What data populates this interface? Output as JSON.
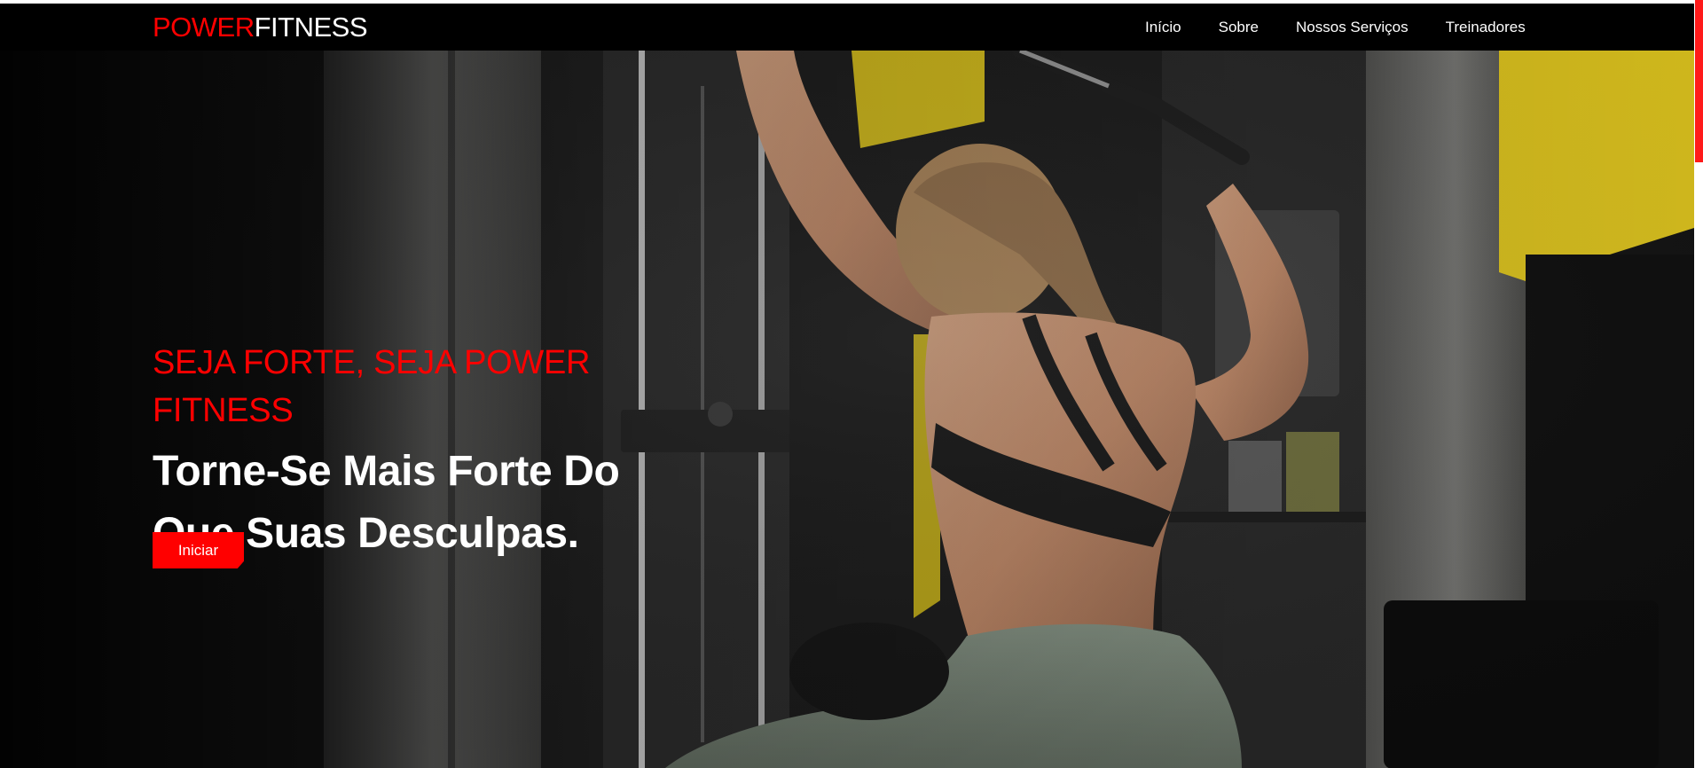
{
  "brand": {
    "part1": "POWER",
    "part2": "FITNESS",
    "color_part1": "#ff0000",
    "color_part2": "#ffffff"
  },
  "nav": {
    "items": [
      {
        "label": "Início"
      },
      {
        "label": "Sobre"
      },
      {
        "label": "Nossos Serviços"
      },
      {
        "label": "Treinadores"
      }
    ]
  },
  "hero": {
    "subtitle": "SEJA FORTE, SEJA POWER FITNESS",
    "title_line1": "Torne-Se Mais Forte Do",
    "title_line2": "Que Suas Desculpas.",
    "cta_label": "Iniciar",
    "accent_color": "#ff0000"
  }
}
